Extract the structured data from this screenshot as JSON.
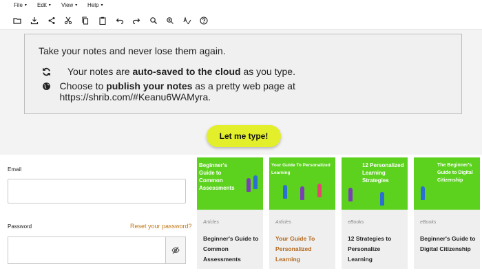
{
  "menubar": {
    "items": [
      {
        "label": "File"
      },
      {
        "label": "Edit"
      },
      {
        "label": "View"
      },
      {
        "label": "Help"
      }
    ],
    "caret": "▾"
  },
  "toolbar": {
    "icons": [
      "folder-icon",
      "download-icon",
      "share-icon",
      "cut-icon",
      "copy-icon",
      "paste-icon",
      "undo-icon",
      "redo-icon",
      "search-icon",
      "zoom-in-icon",
      "spellcheck-icon",
      "help-icon"
    ]
  },
  "notice": {
    "lead": "Take your notes and never lose them again.",
    "autosave": {
      "pre": "Your notes are ",
      "bold": "auto-saved to the cloud",
      "post": " as you type."
    },
    "publish": {
      "pre": "Choose to ",
      "bold": "publish your notes",
      "post": " as a pretty web page at https://shrib.com/#Keanu6WAMyra."
    }
  },
  "cta": {
    "label": "Let me type!"
  },
  "form": {
    "email_label": "Email",
    "password_label": "Password",
    "reset_link": "Reset your password?"
  },
  "cards": [
    {
      "thumb_title": "Beginner's Guide to Common Assessments",
      "kind": "Articles",
      "title": "Beginner's Guide to Common Assessments",
      "accent": "#222222"
    },
    {
      "thumb_title": "Your Guide To Personalized Learning",
      "kind": "Articles",
      "title": "Your Guide To Personalized Learning",
      "accent": "#b3661a"
    },
    {
      "thumb_title": "12 Personalized Learning Strategies",
      "kind": "eBooks",
      "title": "12 Strategies to Personalize Learning",
      "accent": "#222222"
    },
    {
      "thumb_title": "The Beginner's Guide to Digital Citizenship",
      "kind": "eBooks",
      "title": "Beginner's Guide to Digital Citizenship",
      "accent": "#222222"
    }
  ],
  "colors": {
    "cta": "#e3ef2b",
    "thumb_green": "#5cd21e",
    "reset_link": "#c27b1a"
  }
}
